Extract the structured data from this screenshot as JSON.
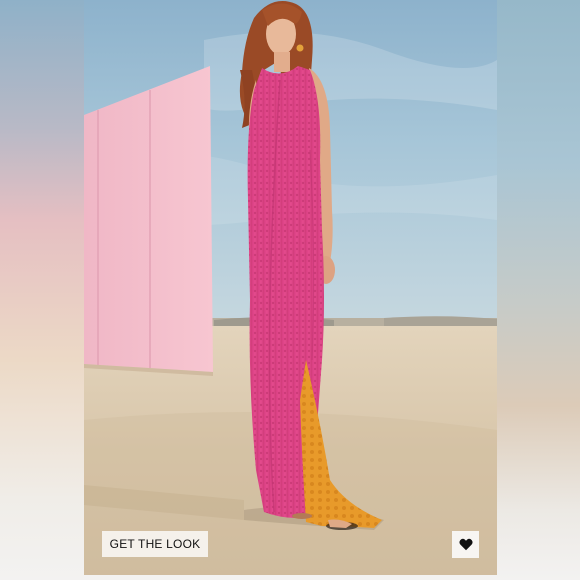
{
  "product_photo": {
    "alt_label": "",
    "accent_colors": {
      "dress": "#e0488a",
      "underskirt": "#e79a2c",
      "wall": "#f3b9c7",
      "sky_top": "#8fb6d0",
      "sand": "#d8c6ab"
    }
  },
  "actions": {
    "get_the_look_label": "GET THE LOOK",
    "favorite_icon": "heart-icon"
  }
}
